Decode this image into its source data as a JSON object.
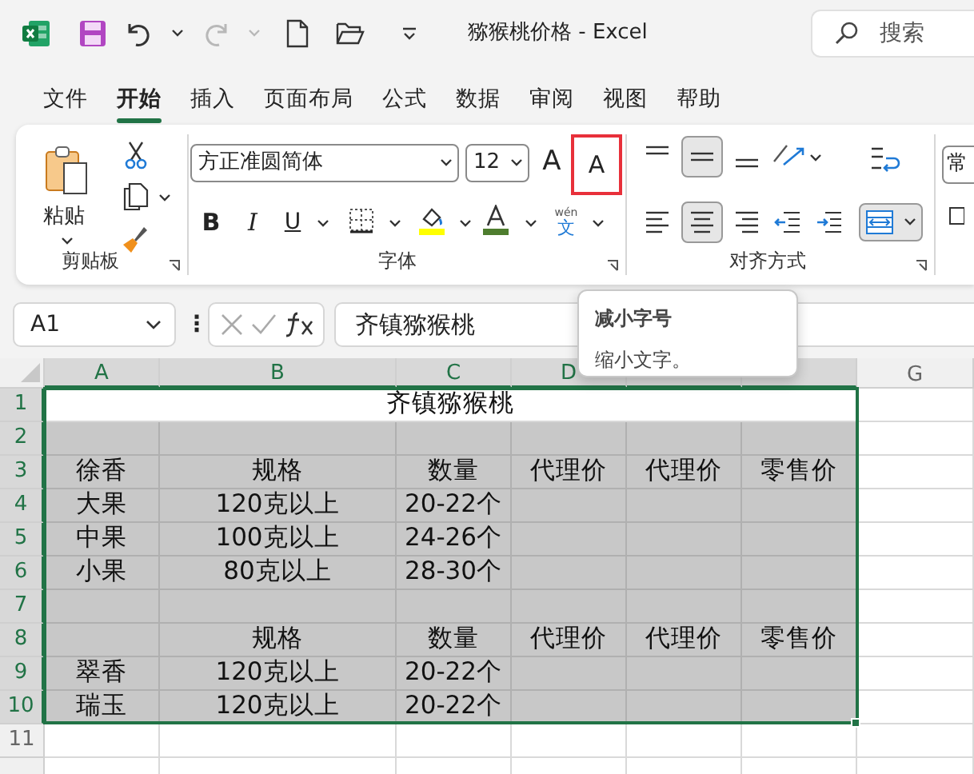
{
  "title_bar": {
    "title": "猕猴桃价格  -  Excel",
    "redo_disabled": true,
    "search": {
      "placeholder": "搜索"
    }
  },
  "tabs": [
    {
      "label": "文件",
      "selected": false
    },
    {
      "label": "开始",
      "selected": true
    },
    {
      "label": "插入",
      "selected": false
    },
    {
      "label": "页面布局",
      "selected": false
    },
    {
      "label": "公式",
      "selected": false
    },
    {
      "label": "数据",
      "selected": false
    },
    {
      "label": "审阅",
      "selected": false
    },
    {
      "label": "视图",
      "selected": false
    },
    {
      "label": "帮助",
      "selected": false
    }
  ],
  "ribbon": {
    "clipboard": {
      "paste_label": "粘贴",
      "group_label": "剪贴板"
    },
    "font": {
      "font_name": "方正准圆简体",
      "font_size": "12",
      "grow": "A",
      "shrink": {
        "label": "A",
        "highlighted": true
      },
      "bold": "B",
      "italic": "I",
      "underline": "U",
      "phonetic_top": "wén",
      "phonetic_char": "文",
      "group_label": "字体"
    },
    "alignment": {
      "vertical": [
        {
          "selected": false
        },
        {
          "selected": true
        },
        {
          "selected": false
        }
      ],
      "horizontal": [
        {
          "selected": false
        },
        {
          "selected": true
        },
        {
          "selected": false
        }
      ],
      "merge_selected": true,
      "group_label": "对齐方式"
    },
    "number_format": "常"
  },
  "formula_bar": {
    "name_box": "A1",
    "more": "⋮",
    "formula": "齐镇猕猴桃"
  },
  "tooltip": {
    "title": "减小字号",
    "text": "缩小文字。"
  },
  "sheet": {
    "columns": [
      {
        "label": "A",
        "in_selection": true
      },
      {
        "label": "B",
        "in_selection": true
      },
      {
        "label": "C",
        "in_selection": true
      },
      {
        "label": "D",
        "in_selection": true
      },
      {
        "in_selection": true
      },
      {
        "in_selection": true
      },
      {
        "label": "G",
        "in_selection": false
      }
    ],
    "rows": [
      {
        "number": "1",
        "shaded": false,
        "in_selection": true,
        "merged": "齐镇猕猴桃"
      },
      {
        "number": "2",
        "shaded": true,
        "in_selection": true,
        "cells": [
          null,
          null,
          null,
          null,
          null,
          null
        ]
      },
      {
        "number": "3",
        "shaded": true,
        "in_selection": true,
        "cells": [
          "徐香",
          "规格",
          "数量",
          "代理价",
          "代理价",
          "零售价"
        ]
      },
      {
        "number": "4",
        "shaded": true,
        "in_selection": true,
        "cells": [
          "大果",
          "120克以上",
          "20-22个",
          null,
          null,
          null
        ]
      },
      {
        "number": "5",
        "shaded": true,
        "in_selection": true,
        "cells": [
          "中果",
          "100克以上",
          "24-26个",
          null,
          null,
          null
        ]
      },
      {
        "number": "6",
        "shaded": true,
        "in_selection": true,
        "cells": [
          "小果",
          "80克以上",
          "28-30个",
          null,
          null,
          null
        ]
      },
      {
        "number": "7",
        "shaded": true,
        "in_selection": true,
        "cells": [
          null,
          null,
          null,
          null,
          null,
          null
        ]
      },
      {
        "number": "8",
        "shaded": true,
        "in_selection": true,
        "cells": [
          null,
          "规格",
          "数量",
          "代理价",
          "代理价",
          "零售价"
        ]
      },
      {
        "number": "9",
        "shaded": true,
        "in_selection": true,
        "cells": [
          "翠香",
          "120克以上",
          "20-22个",
          null,
          null,
          null
        ]
      },
      {
        "number": "10",
        "shaded": true,
        "in_selection": true,
        "cells": [
          "瑞玉",
          "120克以上",
          "20-22个",
          null,
          null,
          null
        ]
      },
      {
        "number": "11",
        "shaded": false,
        "in_selection": false,
        "cells": [
          null,
          null,
          null,
          null,
          null,
          null
        ]
      }
    ]
  }
}
